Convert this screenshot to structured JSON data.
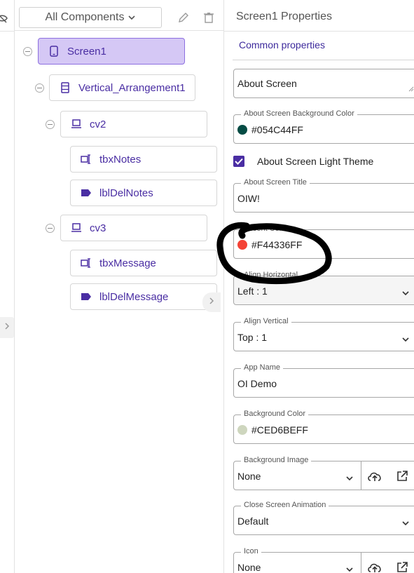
{
  "toolbar": {
    "filter_label": "All Components"
  },
  "tree": {
    "nodes": [
      {
        "label": "Screen1",
        "icon": "phone-icon"
      },
      {
        "label": "Vertical_Arrangement1",
        "icon": "vertical-arrangement-icon"
      },
      {
        "label": "cv2",
        "icon": "card-view-icon"
      },
      {
        "label": "tbxNotes",
        "icon": "textbox-icon"
      },
      {
        "label": "lblDelNotes",
        "icon": "label-icon"
      },
      {
        "label": "cv3",
        "icon": "card-view-icon"
      },
      {
        "label": "tbxMessage",
        "icon": "textbox-icon"
      },
      {
        "label": "lblDelMessage",
        "icon": "label-icon"
      }
    ]
  },
  "properties": {
    "title": "Screen1 Properties",
    "section": "Common properties",
    "about_screen": "About Screen",
    "about_bg_color": {
      "label": "About Screen Background Color",
      "value": "#054C44FF",
      "swatch": "#054c44"
    },
    "light_theme": {
      "label": "About Screen Light Theme",
      "checked": true
    },
    "about_title": {
      "label": "About Screen Title",
      "value": "OIW!"
    },
    "accent_color": {
      "label": "Accent Color",
      "value": "#F44336FF",
      "swatch": "#f44336"
    },
    "align_horizontal": {
      "label": "Align Horizontal",
      "value": "Left : 1"
    },
    "align_vertical": {
      "label": "Align Vertical",
      "value": "Top : 1"
    },
    "app_name": {
      "label": "App Name",
      "value": "OI Demo"
    },
    "background_color": {
      "label": "Background Color",
      "value": "#CED6BEFF",
      "swatch": "#ced6be"
    },
    "background_image": {
      "label": "Background Image",
      "value": "None"
    },
    "close_animation": {
      "label": "Close Screen Animation",
      "value": "Default"
    },
    "icon": {
      "label": "Icon",
      "value": "None"
    }
  },
  "colors": {
    "accent": "#4a2ea3",
    "selected_bg": "#d5c8f5",
    "annotation": "#000000"
  }
}
